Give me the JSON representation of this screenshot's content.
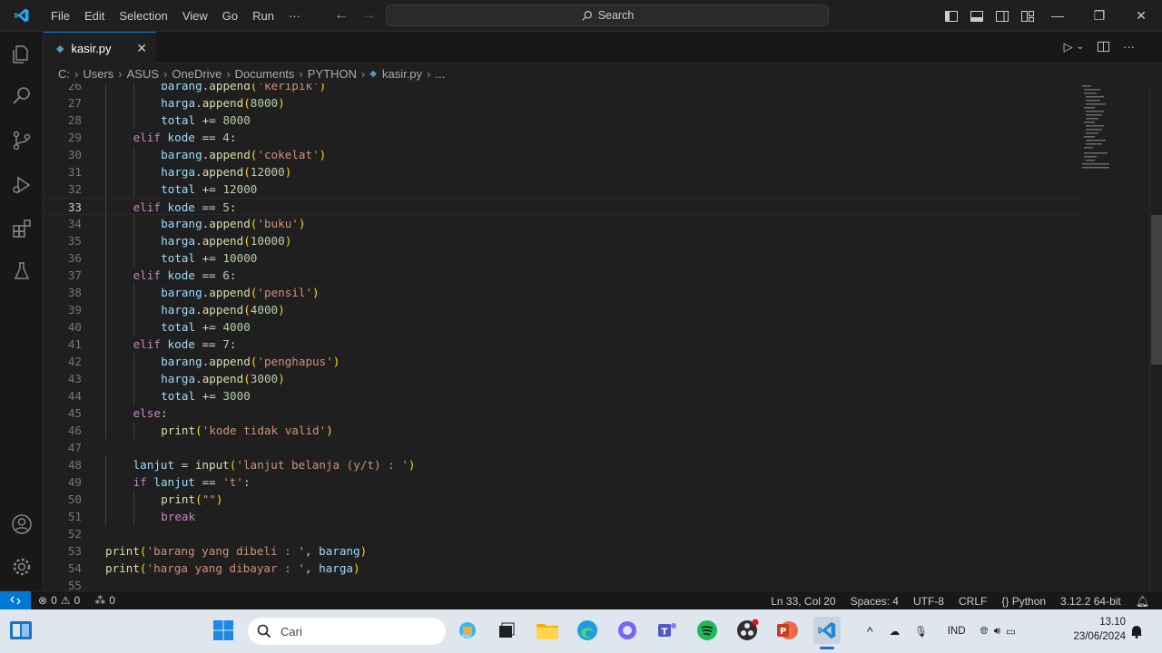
{
  "titlebar": {
    "menu": [
      "File",
      "Edit",
      "Selection",
      "View",
      "Go",
      "Run",
      "···"
    ],
    "search_placeholder": "Search"
  },
  "tab": {
    "label": "kasir.py"
  },
  "breadcrumb": [
    "C:",
    "Users",
    "ASUS",
    "OneDrive",
    "Documents",
    "PYTHON",
    "kasir.py",
    "..."
  ],
  "editor": {
    "lines": [
      {
        "n": "26",
        "indent": 2,
        "tokens": [
          [
            "var",
            "barang"
          ],
          [
            "op",
            "."
          ],
          [
            "fn",
            "append"
          ],
          [
            "p1",
            "("
          ],
          [
            "str",
            "'keripik'"
          ],
          [
            "p1",
            ")"
          ]
        ]
      },
      {
        "n": "27",
        "indent": 2,
        "tokens": [
          [
            "var",
            "harga"
          ],
          [
            "op",
            "."
          ],
          [
            "fn",
            "append"
          ],
          [
            "p1",
            "("
          ],
          [
            "num",
            "8000"
          ],
          [
            "p1",
            ")"
          ]
        ]
      },
      {
        "n": "28",
        "indent": 2,
        "tokens": [
          [
            "var",
            "total"
          ],
          [
            "op",
            " += "
          ],
          [
            "num",
            "8000"
          ]
        ]
      },
      {
        "n": "29",
        "indent": 1,
        "tokens": [
          [
            "kw",
            "elif"
          ],
          [
            "op",
            " "
          ],
          [
            "var",
            "kode"
          ],
          [
            "op",
            " == "
          ],
          [
            "num",
            "4"
          ],
          [
            "op",
            ":"
          ]
        ]
      },
      {
        "n": "30",
        "indent": 2,
        "tokens": [
          [
            "var",
            "barang"
          ],
          [
            "op",
            "."
          ],
          [
            "fn",
            "append"
          ],
          [
            "p1",
            "("
          ],
          [
            "str",
            "'cokelat'"
          ],
          [
            "p1",
            ")"
          ]
        ]
      },
      {
        "n": "31",
        "indent": 2,
        "tokens": [
          [
            "var",
            "harga"
          ],
          [
            "op",
            "."
          ],
          [
            "fn",
            "append"
          ],
          [
            "p1",
            "("
          ],
          [
            "num",
            "12000"
          ],
          [
            "p1",
            ")"
          ]
        ]
      },
      {
        "n": "32",
        "indent": 2,
        "tokens": [
          [
            "var",
            "total"
          ],
          [
            "op",
            " += "
          ],
          [
            "num",
            "12000"
          ]
        ]
      },
      {
        "n": "33",
        "indent": 1,
        "tokens": [
          [
            "kw",
            "elif"
          ],
          [
            "op",
            " "
          ],
          [
            "var",
            "kode"
          ],
          [
            "op",
            " == "
          ],
          [
            "num",
            "5"
          ],
          [
            "op",
            ":"
          ]
        ]
      },
      {
        "n": "34",
        "indent": 2,
        "tokens": [
          [
            "var",
            "barang"
          ],
          [
            "op",
            "."
          ],
          [
            "fn",
            "append"
          ],
          [
            "p1",
            "("
          ],
          [
            "str",
            "'buku'"
          ],
          [
            "p1",
            ")"
          ]
        ]
      },
      {
        "n": "35",
        "indent": 2,
        "tokens": [
          [
            "var",
            "harga"
          ],
          [
            "op",
            "."
          ],
          [
            "fn",
            "append"
          ],
          [
            "p1",
            "("
          ],
          [
            "num",
            "10000"
          ],
          [
            "p1",
            ")"
          ]
        ]
      },
      {
        "n": "36",
        "indent": 2,
        "tokens": [
          [
            "var",
            "total"
          ],
          [
            "op",
            " += "
          ],
          [
            "num",
            "10000"
          ]
        ]
      },
      {
        "n": "37",
        "indent": 1,
        "tokens": [
          [
            "kw",
            "elif"
          ],
          [
            "op",
            " "
          ],
          [
            "var",
            "kode"
          ],
          [
            "op",
            " == "
          ],
          [
            "num",
            "6"
          ],
          [
            "op",
            ":"
          ]
        ]
      },
      {
        "n": "38",
        "indent": 2,
        "tokens": [
          [
            "var",
            "barang"
          ],
          [
            "op",
            "."
          ],
          [
            "fn",
            "append"
          ],
          [
            "p1",
            "("
          ],
          [
            "str",
            "'pensil'"
          ],
          [
            "p1",
            ")"
          ]
        ]
      },
      {
        "n": "39",
        "indent": 2,
        "tokens": [
          [
            "var",
            "harga"
          ],
          [
            "op",
            "."
          ],
          [
            "fn",
            "append"
          ],
          [
            "p1",
            "("
          ],
          [
            "num",
            "4000"
          ],
          [
            "p1",
            ")"
          ]
        ]
      },
      {
        "n": "40",
        "indent": 2,
        "tokens": [
          [
            "var",
            "total"
          ],
          [
            "op",
            " += "
          ],
          [
            "num",
            "4000"
          ]
        ]
      },
      {
        "n": "41",
        "indent": 1,
        "tokens": [
          [
            "kw",
            "elif"
          ],
          [
            "op",
            " "
          ],
          [
            "var",
            "kode"
          ],
          [
            "op",
            " == "
          ],
          [
            "num",
            "7"
          ],
          [
            "op",
            ":"
          ]
        ]
      },
      {
        "n": "42",
        "indent": 2,
        "tokens": [
          [
            "var",
            "barang"
          ],
          [
            "op",
            "."
          ],
          [
            "fn",
            "append"
          ],
          [
            "p1",
            "("
          ],
          [
            "str",
            "'penghapus'"
          ],
          [
            "p1",
            ")"
          ]
        ]
      },
      {
        "n": "43",
        "indent": 2,
        "tokens": [
          [
            "var",
            "harga"
          ],
          [
            "op",
            "."
          ],
          [
            "fn",
            "append"
          ],
          [
            "p1",
            "("
          ],
          [
            "num",
            "3000"
          ],
          [
            "p1",
            ")"
          ]
        ]
      },
      {
        "n": "44",
        "indent": 2,
        "tokens": [
          [
            "var",
            "total"
          ],
          [
            "op",
            " += "
          ],
          [
            "num",
            "3000"
          ]
        ]
      },
      {
        "n": "45",
        "indent": 1,
        "tokens": [
          [
            "kw",
            "else"
          ],
          [
            "op",
            ":"
          ]
        ]
      },
      {
        "n": "46",
        "indent": 2,
        "tokens": [
          [
            "fn",
            "print"
          ],
          [
            "p1",
            "("
          ],
          [
            "str",
            "'kode tidak valid'"
          ],
          [
            "p1",
            ")"
          ]
        ]
      },
      {
        "n": "47",
        "indent": 0,
        "tokens": []
      },
      {
        "n": "48",
        "indent": 1,
        "tokens": [
          [
            "var",
            "lanjut"
          ],
          [
            "op",
            " = "
          ],
          [
            "fn",
            "input"
          ],
          [
            "p1",
            "("
          ],
          [
            "str",
            "'lanjut belanja (y/t) : '"
          ],
          [
            "p1",
            ")"
          ]
        ]
      },
      {
        "n": "49",
        "indent": 1,
        "tokens": [
          [
            "kw",
            "if"
          ],
          [
            "op",
            " "
          ],
          [
            "var",
            "lanjut"
          ],
          [
            "op",
            " == "
          ],
          [
            "str",
            "'t'"
          ],
          [
            "op",
            ":"
          ]
        ]
      },
      {
        "n": "50",
        "indent": 2,
        "tokens": [
          [
            "fn",
            "print"
          ],
          [
            "p1",
            "("
          ],
          [
            "str",
            "\"\""
          ],
          [
            "p1",
            ")"
          ]
        ]
      },
      {
        "n": "51",
        "indent": 2,
        "tokens": [
          [
            "kw",
            "break"
          ]
        ]
      },
      {
        "n": "52",
        "indent": 0,
        "tokens": []
      },
      {
        "n": "53",
        "indent": 0,
        "tokens": [
          [
            "fn",
            "print"
          ],
          [
            "p1",
            "("
          ],
          [
            "str",
            "'barang yang dibeli : '"
          ],
          [
            "op",
            ", "
          ],
          [
            "var",
            "barang"
          ],
          [
            "p1",
            ")"
          ]
        ]
      },
      {
        "n": "54",
        "indent": 0,
        "tokens": [
          [
            "fn",
            "print"
          ],
          [
            "p1",
            "("
          ],
          [
            "str",
            "'harga yang dibayar : '"
          ],
          [
            "op",
            ", "
          ],
          [
            "var",
            "harga"
          ],
          [
            "p1",
            ")"
          ]
        ]
      },
      {
        "n": "55",
        "indent": 0,
        "tokens": []
      }
    ],
    "current_line": "33"
  },
  "statusbar": {
    "errors": "0",
    "warnings": "0",
    "ports": "0",
    "position": "Ln 33, Col 20",
    "spaces": "Spaces: 4",
    "encoding": "UTF-8",
    "eol": "CRLF",
    "language": "Python",
    "interpreter": "3.12.2 64-bit"
  },
  "taskbar": {
    "search_placeholder": "Cari",
    "lang": "IND",
    "time": "13.10",
    "date": "23/06/2024"
  },
  "colors": {
    "accent": "#0078d4",
    "keyword": "#c586c0",
    "variable": "#9cdcfe",
    "function": "#dcdcaa",
    "number": "#b5cea8",
    "string": "#ce9178"
  }
}
